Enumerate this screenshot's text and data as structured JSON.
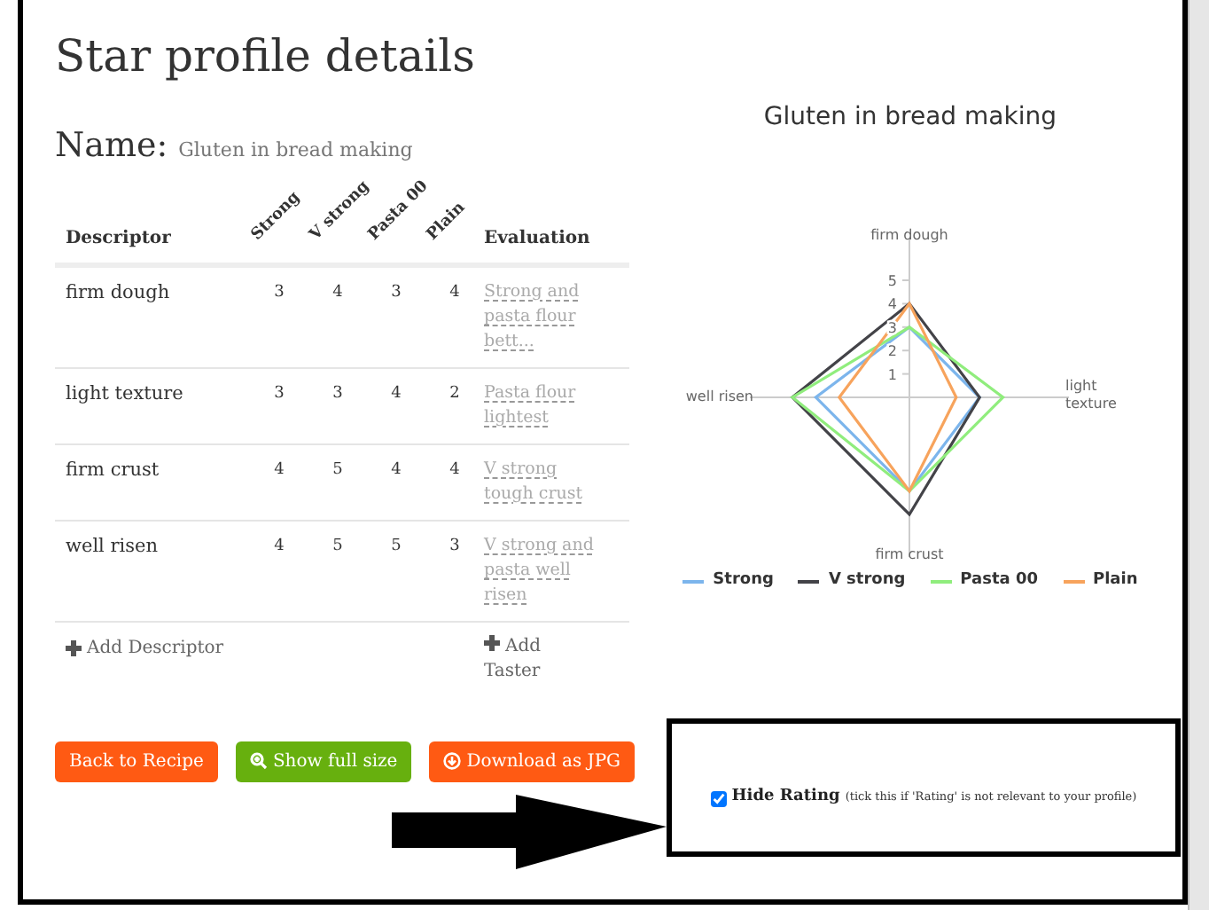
{
  "page": {
    "title": "Star profile details",
    "name_label": "Name:",
    "name_value": "Gluten in bread making"
  },
  "table": {
    "descriptor_heading": "Descriptor",
    "tasters": [
      "Strong",
      "V strong",
      "Pasta 00",
      "Plain"
    ],
    "evaluation_heading": "Evaluation",
    "rows": [
      {
        "descriptor": "firm dough",
        "scores": [
          "3",
          "4",
          "3",
          "4"
        ],
        "evaluation": "Strong and pasta flour bett..."
      },
      {
        "descriptor": "light texture",
        "scores": [
          "3",
          "3",
          "4",
          "2"
        ],
        "evaluation": "Pasta flour lightest"
      },
      {
        "descriptor": "firm crust",
        "scores": [
          "4",
          "5",
          "4",
          "4"
        ],
        "evaluation": "V strong tough crust"
      },
      {
        "descriptor": "well risen",
        "scores": [
          "4",
          "5",
          "5",
          "3"
        ],
        "evaluation": "V strong and pasta well risen"
      }
    ],
    "add_descriptor": "Add Descriptor",
    "add_taster": "Add Taster"
  },
  "chart": {
    "title": "Gluten in bread making",
    "axis_labels": [
      "firm dough",
      "light texture",
      "firm crust",
      "well risen"
    ],
    "ticks": [
      "5",
      "4",
      "3",
      "2",
      "1"
    ],
    "legend": [
      {
        "name": "Strong",
        "color": "#7cb5ec"
      },
      {
        "name": "V strong",
        "color": "#434348"
      },
      {
        "name": "Pasta 00",
        "color": "#90ed7d"
      },
      {
        "name": "Plain",
        "color": "#f7a35c"
      }
    ]
  },
  "buttons": [
    {
      "label": "Back to Recipe",
      "kind": "back"
    },
    {
      "label": "Show full size",
      "kind": "zoom"
    },
    {
      "label": "Download as JPG",
      "kind": "download"
    }
  ],
  "hide_rating": {
    "label": "Hide Rating",
    "hint": "(tick this if 'Rating' is not relevant to your profile)",
    "checked": true
  }
}
